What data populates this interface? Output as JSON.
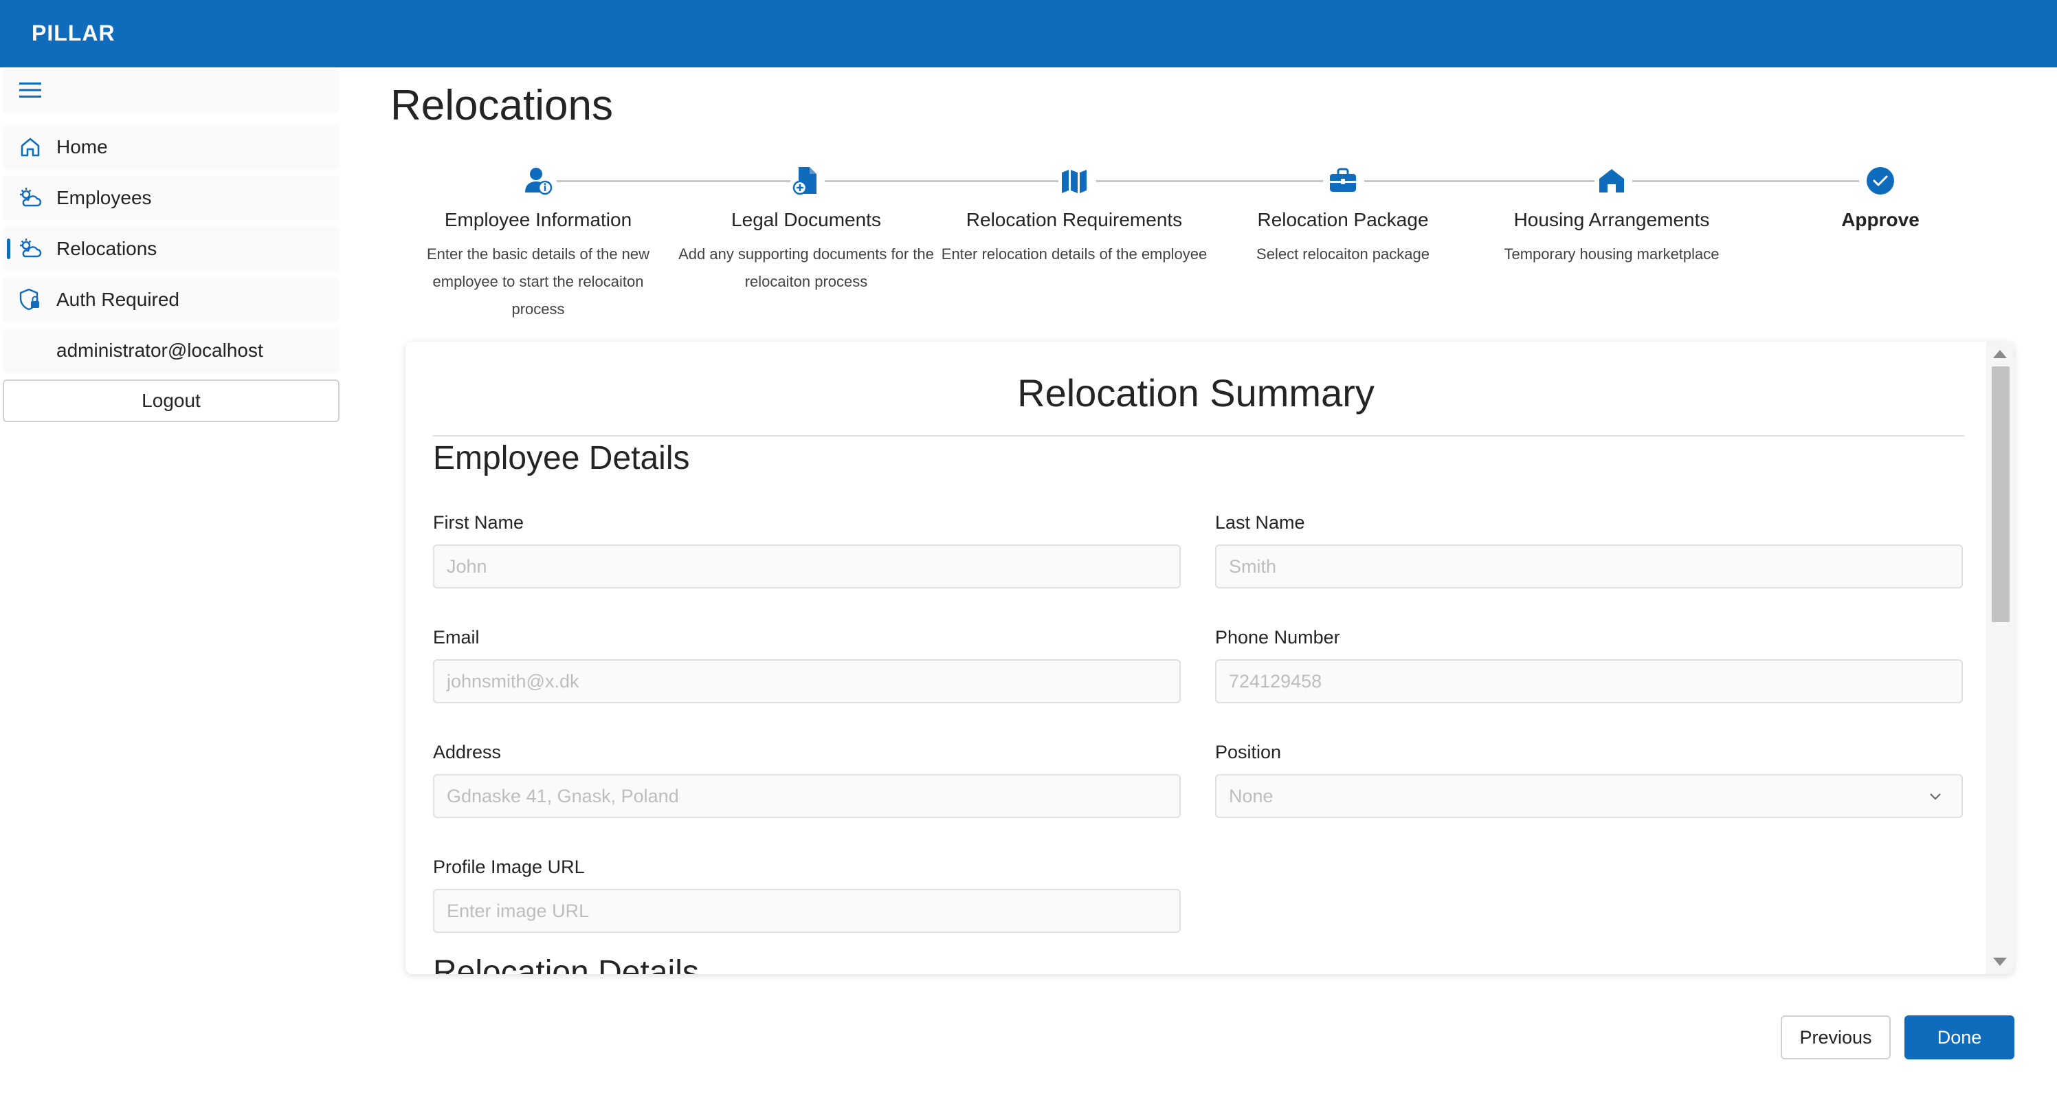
{
  "app": {
    "brand": "PILLAR",
    "page_title": "Relocations"
  },
  "sidebar": {
    "items": [
      {
        "label": "Home",
        "icon": "home-icon"
      },
      {
        "label": "Employees",
        "icon": "weather-partly-cloudy-icon"
      },
      {
        "label": "Relocations",
        "icon": "weather-partly-cloudy-icon",
        "active": true
      },
      {
        "label": "Auth Required",
        "icon": "shield-lock-icon"
      }
    ],
    "user": "administrator@localhost",
    "logout_label": "Logout"
  },
  "stepper": {
    "steps": [
      {
        "title": "Employee Information",
        "description": "Enter the basic details of the new employee to start the relocaiton process",
        "icon": "person-info-icon"
      },
      {
        "title": "Legal Documents",
        "description": "Add any supporting documents for the relocaiton process",
        "icon": "document-add-icon"
      },
      {
        "title": "Relocation Requirements",
        "description": "Enter relocation details of the employee",
        "icon": "map-icon"
      },
      {
        "title": "Relocation Package",
        "description": "Select relocaiton package",
        "icon": "briefcase-icon"
      },
      {
        "title": "Housing Arrangements",
        "description": "Temporary housing marketplace",
        "icon": "house-icon"
      },
      {
        "title": "Approve",
        "description": "",
        "icon": "checkmark-circle-icon",
        "current": true
      }
    ]
  },
  "summary": {
    "title": "Relocation Summary",
    "employee_details_title": "Employee Details",
    "next_section_title": "Relocation Details",
    "fields": {
      "first_name": {
        "label": "First Name",
        "value": "John"
      },
      "last_name": {
        "label": "Last Name",
        "value": "Smith"
      },
      "email": {
        "label": "Email",
        "value": "johnsmith@x.dk"
      },
      "phone": {
        "label": "Phone Number",
        "value": "724129458"
      },
      "address": {
        "label": "Address",
        "value": "Gdnaske 41, Gnask, Poland"
      },
      "position": {
        "label": "Position",
        "value": "None"
      },
      "profile_image": {
        "label": "Profile Image URL",
        "placeholder": "Enter image URL"
      }
    }
  },
  "actions": {
    "previous_label": "Previous",
    "done_label": "Done"
  },
  "colors": {
    "brand": "#0f6cbd",
    "text": "#242424",
    "muted": "#bdbdbd"
  }
}
